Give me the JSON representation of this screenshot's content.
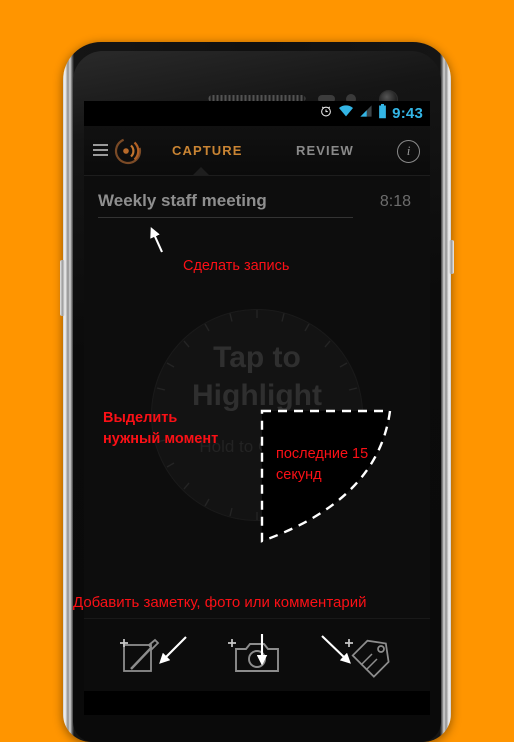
{
  "background_color": "#ff9500",
  "device": {
    "name": "android-smartphone",
    "parts": [
      "earpiece-speaker",
      "proximity-sensor",
      "light-sensor",
      "front-camera",
      "volume-button",
      "power-button"
    ]
  },
  "status_bar": {
    "icons": [
      "alarm-icon",
      "wifi-icon",
      "signal-icon",
      "battery-icon"
    ],
    "time": "9:43",
    "accent_color": "#33b5e5"
  },
  "action_bar": {
    "menu_icon": "hamburger-menu-icon",
    "logo_icon": "app-logo-icon",
    "tabs": [
      {
        "label": "CAPTURE",
        "active": true,
        "color": "#c98433"
      },
      {
        "label": "REVIEW",
        "active": false,
        "color": "#8a8a8a"
      }
    ],
    "info_icon": "info-icon",
    "info_glyph": "i"
  },
  "title_row": {
    "session_title": "Weekly staff meeting",
    "session_title_placeholder": "Weekly staff meeting",
    "duration": "8:18"
  },
  "highlight": {
    "label": "Tap to\nHighlight",
    "sublabel": "Hold to\nCurrent"
  },
  "toolbar": {
    "items": [
      {
        "icon": "add-note-icon",
        "label": ""
      },
      {
        "icon": "add-photo-camera-icon",
        "label": ""
      },
      {
        "icon": "add-tag-icon",
        "label": ""
      }
    ]
  },
  "annotations": {
    "color": "#fb1016",
    "make_record": "Сделать запись",
    "select_moment": "Выделить\nнужный момент",
    "last_15_seconds": "последние 15\nсекунд",
    "add_note_photo_comment": "Добавить заметку, фото или комментарий",
    "arrows": [
      "arrow-up-to-title",
      "arrow-down-left-to-note",
      "arrow-down-to-camera",
      "arrow-down-right-to-tag"
    ],
    "dashed_region": "last-15-seconds-highlight-region"
  }
}
